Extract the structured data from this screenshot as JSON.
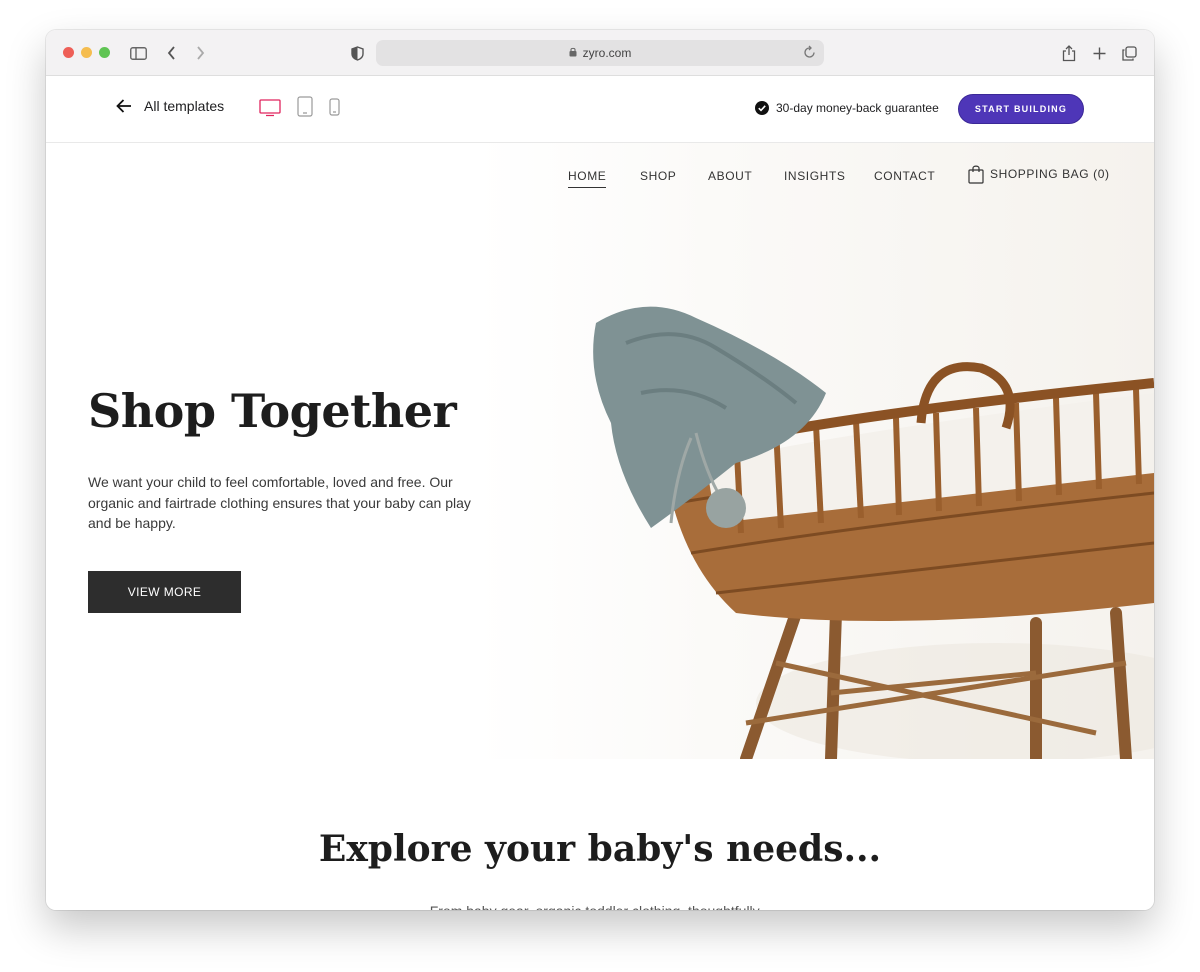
{
  "browser": {
    "url": "zyro.com"
  },
  "editor": {
    "back_label": "All templates",
    "guarantee": "30-day money-back guarantee",
    "start_button": "START BUILDING"
  },
  "site": {
    "nav": {
      "home": "HOME",
      "shop": "SHOP",
      "about": "ABOUT",
      "insights": "INSIGHTS",
      "contact": "CONTACT",
      "bag": "SHOPPING BAG (0)"
    },
    "hero": {
      "title": "Shop Together",
      "text": "We want your child to feel comfortable, loved and free. Our organic and fairtrade clothing ensures that your baby can play and be happy.",
      "button": "VIEW MORE"
    },
    "section": {
      "title": "Explore your baby's needs...",
      "subtitle": "From baby gear, organic toddler clothing, thoughtfully..."
    }
  },
  "colors": {
    "accent": "#4e36b8",
    "device_active": "#e0245e",
    "dark_button": "#2d2d2d"
  }
}
